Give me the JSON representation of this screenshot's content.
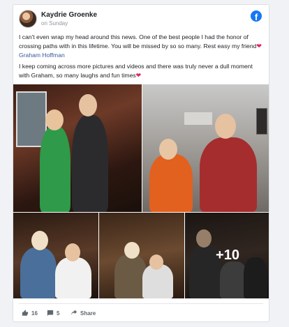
{
  "post": {
    "author": "Kaydrie Groenke",
    "date": "on Sunday",
    "paragraph1_a": "I can't even wrap my head around this news. One of the best people I had the honor of crossing paths with in this lifetime. You will be missed by so so many. Rest easy my friend",
    "paragraph1_mention": "Graham Hoffman",
    "paragraph2": "I keep coming across more pictures and videos and there was truly never a dull moment with Graham, so many laughs and fun times",
    "heart_glyph": "❤",
    "more_photos": "+10"
  },
  "footer": {
    "likes": "16",
    "comments": "5",
    "share_label": "Share"
  },
  "colors": {
    "facebook_blue": "#1877f2",
    "mention": "#385898",
    "heart": "#e0245e"
  },
  "icons": [
    "facebook-icon",
    "like-icon",
    "comment-icon",
    "share-icon"
  ]
}
